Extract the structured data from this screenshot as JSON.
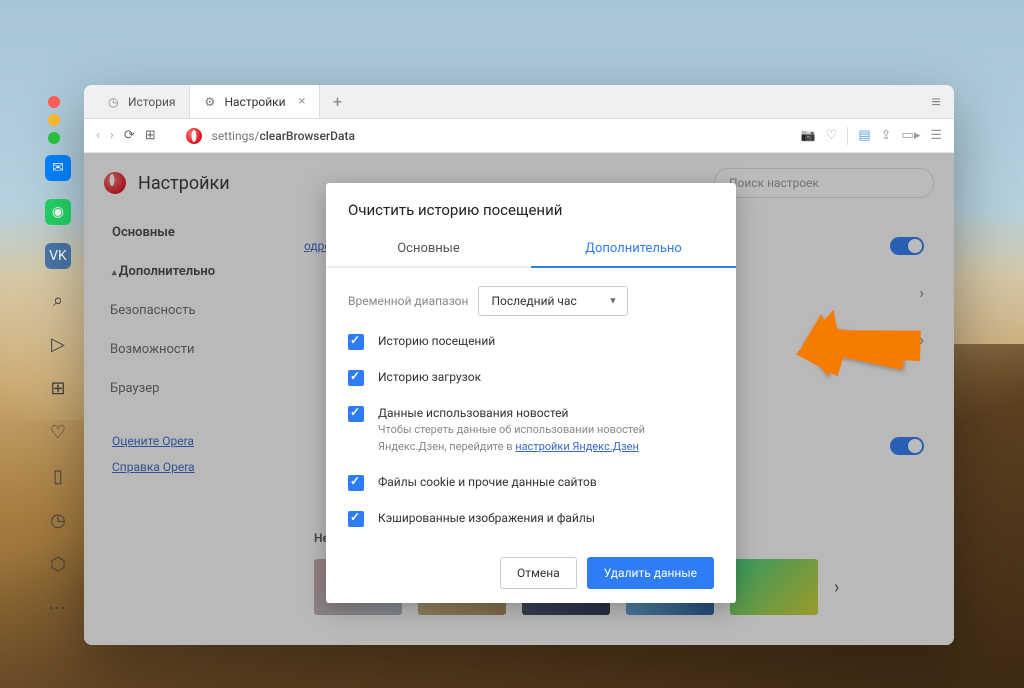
{
  "tabs": {
    "history": "История",
    "settings": "Настройки"
  },
  "address": {
    "path": "settings/",
    "page": "clearBrowserData"
  },
  "page": {
    "title": "Настройки",
    "search_placeholder": "Поиск настроек",
    "nav": {
      "main": "Основные",
      "advanced": "Дополнительно",
      "security": "Безопасность",
      "features": "Возможности",
      "browser": "Браузер",
      "rate": "Оцените Opera",
      "help": "Справка Opera"
    },
    "more_link": "одробнее...",
    "section_recent": "Недавние фоновые рисунки"
  },
  "dialog": {
    "title": "Очистить историю посещений",
    "tab_basic": "Основные",
    "tab_advanced": "Дополнительно",
    "time_label": "Временной диапазон",
    "time_value": "Последний час",
    "items": {
      "history": "Историю посещений",
      "downloads": "Историю загрузок",
      "news_title": "Данные использования новостей",
      "news_sub": "Чтобы стереть данные об использовании новостей Яндекс.Дзен, перейдите в ",
      "news_link": "настройки Яндекс.Дзен",
      "cookies": "Файлы cookie и прочие данные сайтов",
      "cache": "Кэшированные изображения и файлы"
    },
    "cancel": "Отмена",
    "confirm": "Удалить данные"
  }
}
